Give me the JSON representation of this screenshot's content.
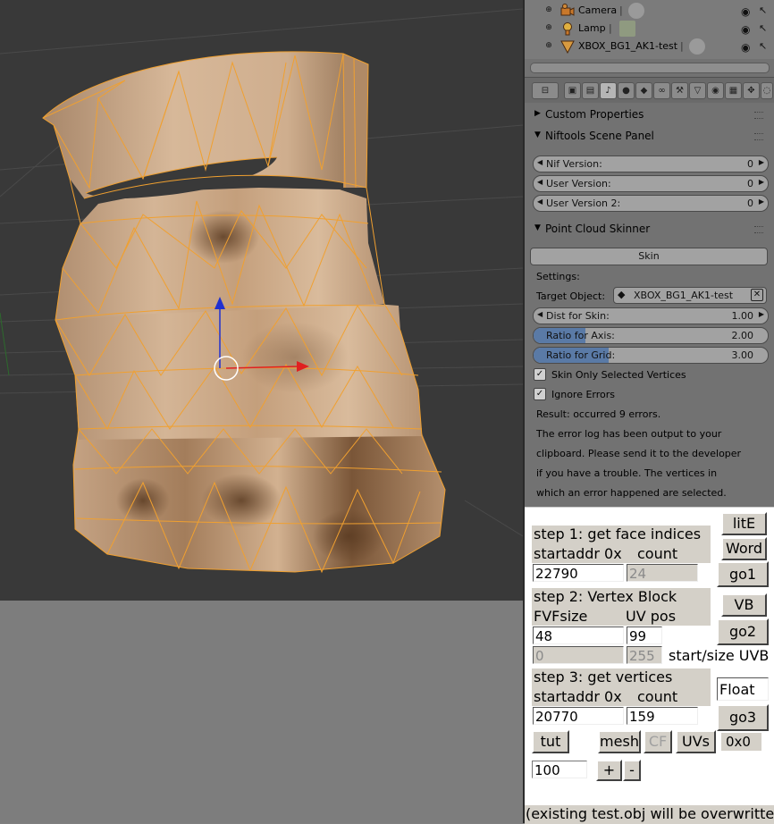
{
  "outliner": {
    "items": [
      {
        "name": "Camera",
        "icon": "camera-icon"
      },
      {
        "name": "Lamp",
        "icon": "lamp-icon"
      },
      {
        "name": "XBOX_BG1_AK1-test",
        "icon": "mesh-object-icon"
      }
    ]
  },
  "properties": {
    "tab_icons": [
      "render-icon",
      "render-layers-icon",
      "scene-icon",
      "world-icon",
      "object-icon",
      "constraints-icon",
      "modifiers-icon",
      "data-icon",
      "material-icon",
      "texture-icon",
      "particles-icon",
      "physics-icon"
    ],
    "panels": {
      "custom_properties": "Custom Properties",
      "niftools": {
        "title": "Niftools Scene Panel",
        "fields": [
          {
            "label": "Nif Version:",
            "value": "0"
          },
          {
            "label": "User Version:",
            "value": "0"
          },
          {
            "label": "User Version 2:",
            "value": "0"
          }
        ]
      },
      "skinner": {
        "title": "Point Cloud Skinner",
        "skin_button": "Skin",
        "settings_label": "Settings:",
        "target_label": "Target Object:",
        "target_value": "XBOX_BG1_AK1-test",
        "dist": {
          "label": "Dist for Skin:",
          "value": "1.00"
        },
        "ratio_axis": {
          "label": "Ratio for Axis:",
          "value": "2.00",
          "fill": 0.22
        },
        "ratio_grid": {
          "label": "Ratio for Grid:",
          "value": "3.00",
          "fill": 0.32
        },
        "check_selected": "Skin Only Selected Vertices",
        "check_ignore": "Ignore Errors",
        "result_lines": [
          "Result: occurred 9 errors.",
          "The error log has been output to your",
          "clipboard. Please send it to the developer",
          "if you have a trouble. The vertices in",
          "which an error happened are selected."
        ]
      }
    }
  },
  "tool": {
    "step1_title": "step 1: get face indices",
    "step1_sub": "startaddr 0x",
    "step1_count_label": "count",
    "step1_addr": "22790",
    "step1_count": "24",
    "btn_lite": "litE",
    "btn_word": "Word",
    "btn_go1": "go1",
    "step2_title": "step 2: Vertex Block",
    "step2_sub": "FVFsize",
    "step2_uv_label": "UV pos",
    "step2_fvf": "48",
    "step2_uv": "99",
    "step2_start": "0",
    "step2_size": "255",
    "step2_startsize_label": "start/size UVB",
    "btn_vb": "VB",
    "btn_go2": "go2",
    "step3_title": "step 3: get vertices",
    "step3_sub": "startaddr 0x",
    "step3_count_label": "count",
    "step3_addr": "20770",
    "step3_count": "159",
    "float_value": "Float",
    "btn_go3": "go3",
    "btn_tut": "tut",
    "btn_mesh": "mesh",
    "btn_cf": "CF",
    "btn_uvs": "UVs",
    "hex_readout": "0x0",
    "scale_value": "100",
    "btn_plus": "+",
    "btn_minus": "-",
    "footer": "(existing test.obj will be overwritten"
  }
}
